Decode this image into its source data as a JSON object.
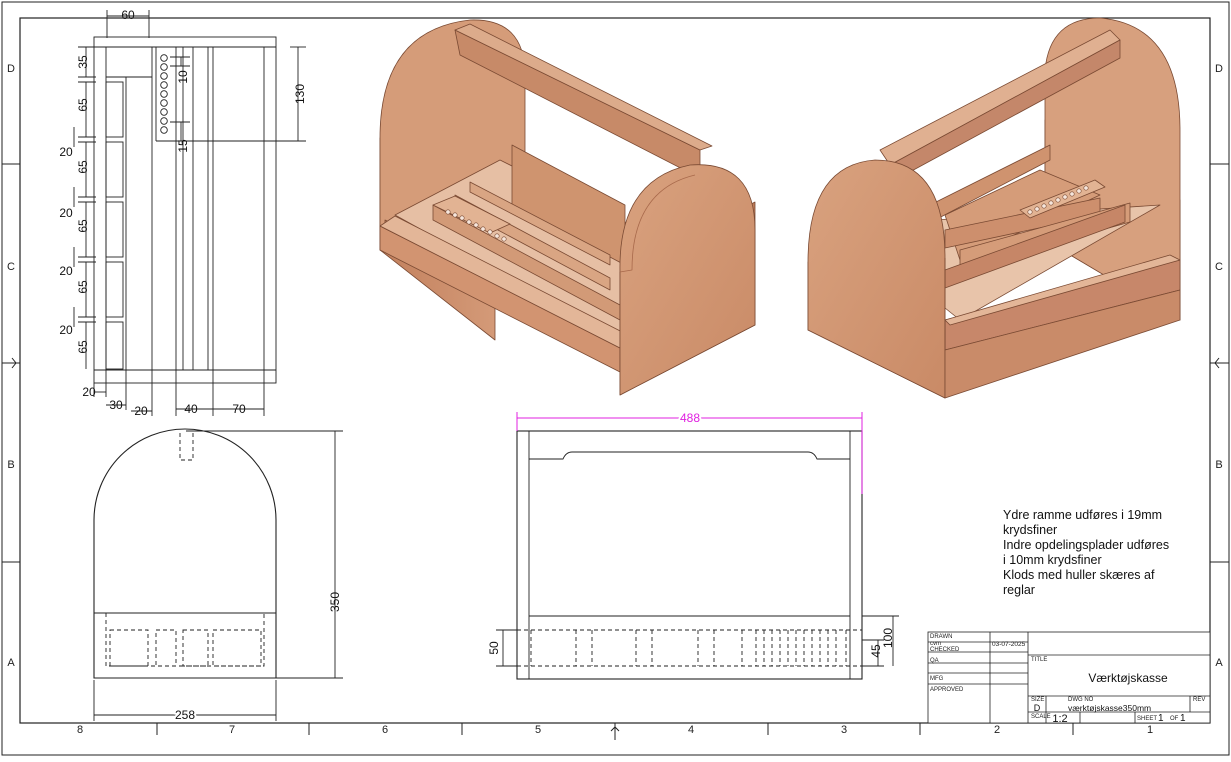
{
  "zones": {
    "columns": [
      "8",
      "7",
      "6",
      "5",
      "4",
      "3",
      "2",
      "1"
    ],
    "rows": [
      "D",
      "C",
      "B",
      "A"
    ]
  },
  "top_view": {
    "dims": {
      "w60": "60",
      "h35": "35",
      "h10": "10",
      "h130": "130",
      "h15": "15",
      "h65a": "65",
      "h20a": "20",
      "h65b": "65",
      "h20b": "20",
      "h65c": "65",
      "h20c": "20",
      "h65d": "65",
      "h20d": "20",
      "h65e": "65",
      "b20a": "20",
      "b30": "30",
      "b20b": "20",
      "b40": "40",
      "b70": "70"
    }
  },
  "side_view": {
    "dims": {
      "height": "350",
      "width": "258"
    }
  },
  "front_view": {
    "dims": {
      "width": "488",
      "h50": "50",
      "h45": "45",
      "h100": "100"
    }
  },
  "notes": [
    "Ydre ramme udføres i 19mm",
    "krydsfiner",
    "Indre opdelingsplader udføres",
    "i 10mm krydsfiner",
    "Klods med huller skæres af",
    "reglar"
  ],
  "title_block": {
    "drawn_label": "DRAWN",
    "drawn_by": "cvm",
    "drawn_date": "03-07-2025",
    "checked_label": "CHECKED",
    "qa_label": "QA",
    "mfg_label": "MFG",
    "approved_label": "APPROVED",
    "title_label": "TITLE",
    "title": "Værktøjskasse",
    "size_label": "SIZE",
    "size": "D",
    "dwg_no_label": "DWG NO",
    "dwg_no": "værktøjskasse350mm",
    "rev_label": "REV",
    "scale_label": "SCALE",
    "scale": "1:2",
    "sheet_label": "SHEET",
    "sheet": "1",
    "of_label": "OF",
    "sheet_total": "1"
  },
  "colors": {
    "wood": "#d49a78",
    "wood_dark": "#b87555",
    "dim_highlight": "#e020e0"
  }
}
